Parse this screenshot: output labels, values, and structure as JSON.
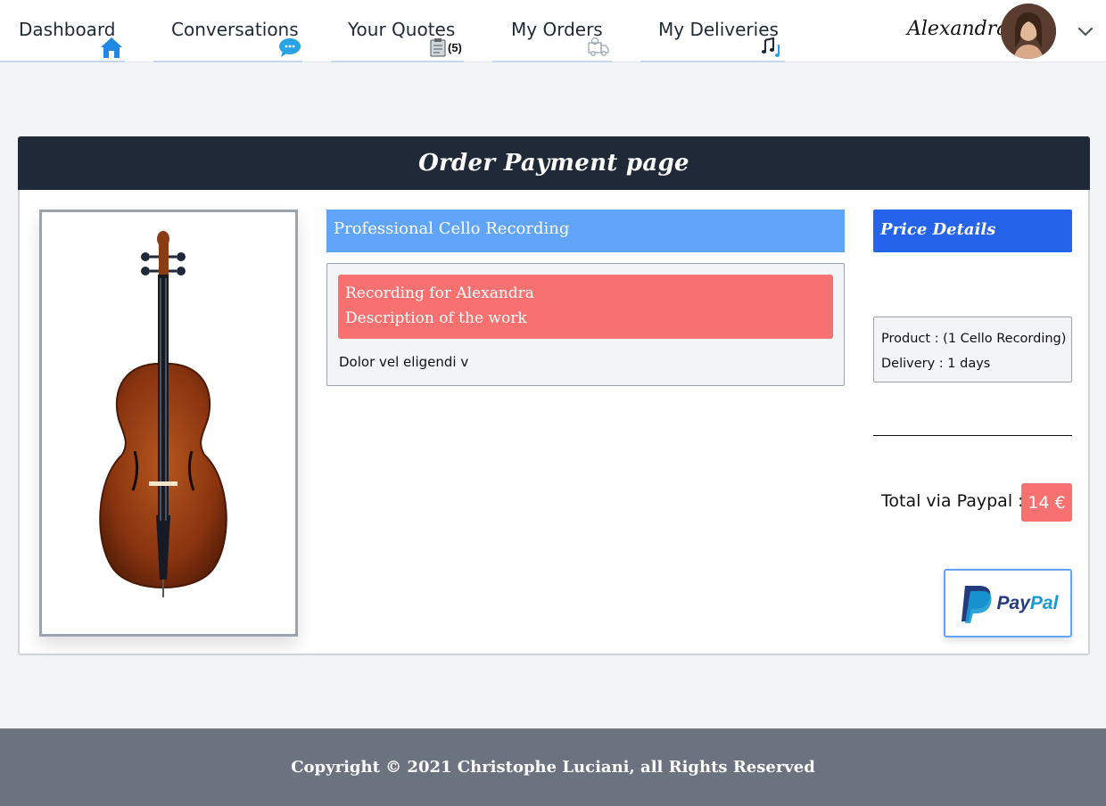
{
  "nav": {
    "items": [
      {
        "label": "Dashboard",
        "icon": "home-icon"
      },
      {
        "label": "Conversations",
        "icon": "chat-bubble-icon"
      },
      {
        "label": "Your Quotes",
        "icon": "clipboard-icon",
        "badge": "(5)"
      },
      {
        "label": "My Orders",
        "icon": "delivery-truck-icon"
      },
      {
        "label": "My Deliveries",
        "icon": "music-notes-icon"
      }
    ],
    "user_name": "Alexandra"
  },
  "card": {
    "title": "Order Payment page",
    "service_title": "Professional Cello Recording",
    "description": {
      "line1": "Recording for Alexandra",
      "line2": "Description of the work",
      "body": "Dolor vel eligendi v"
    },
    "price": {
      "header": "Price Details",
      "product": "Product : (1 Cello Recording)",
      "delivery": "Delivery : 1 days",
      "total_label": "Total via Paypal :",
      "total_value": "14 €",
      "paypal_pay": "Pay",
      "paypal_pal": "Pal"
    }
  },
  "footer": {
    "text": "Copyright © 2021 Christophe Luciani, all Rights Reserved"
  },
  "colors": {
    "header_bg": "#1f2937",
    "service_blue": "#60a5fa",
    "price_blue": "#2563eb",
    "accent_red": "#f87171",
    "footer_bg": "#6b7280"
  }
}
